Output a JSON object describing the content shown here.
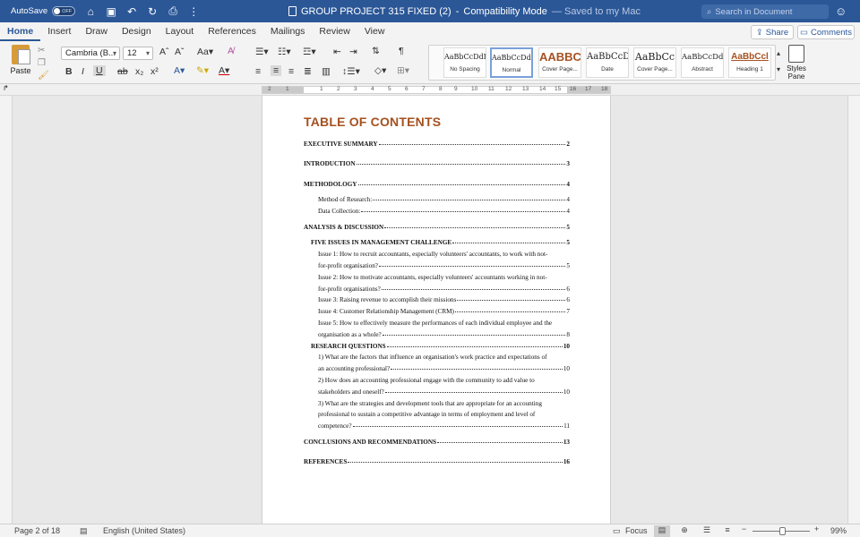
{
  "titlebar": {
    "autosave_label": "AutoSave",
    "autosave_state": "OFF",
    "doc_name": "GROUP PROJECT 315 FIXED (2)",
    "separator": "-",
    "mode": "Compatibility Mode",
    "saved": "— Saved to my Mac",
    "search_placeholder": "Search in Document"
  },
  "tabs": [
    "Home",
    "Insert",
    "Draw",
    "Design",
    "Layout",
    "References",
    "Mailings",
    "Review",
    "View"
  ],
  "share_label": "Share",
  "comments_label": "Comments",
  "ribbon": {
    "paste_label": "Paste",
    "font_name": "Cambria (B...",
    "font_size": "12",
    "styles": [
      {
        "sample": "AaBbCcDdEe",
        "name": "No Spacing"
      },
      {
        "sample": "AaBbCcDdEe",
        "name": "Normal"
      },
      {
        "sample": "AABBC",
        "name": "Cover Page..."
      },
      {
        "sample": "AaBbCcD",
        "name": "Date"
      },
      {
        "sample": "AaBbCc",
        "name": "Cover Page..."
      },
      {
        "sample": "AaBbCcDdE",
        "name": "Abstract"
      },
      {
        "sample": "AaBbCcl",
        "name": "Heading 1"
      }
    ],
    "styles_pane_label": "Styles Pane"
  },
  "ruler_numbers": [
    "2",
    "1",
    "1",
    "2",
    "3",
    "4",
    "5",
    "6",
    "7",
    "8",
    "9",
    "10",
    "11",
    "12",
    "13",
    "14",
    "15",
    "16",
    "17",
    "18"
  ],
  "document": {
    "toc_title": "TABLE OF CONTENTS",
    "entries": [
      {
        "text": "EXECUTIVE SUMMARY",
        "page": "2",
        "level": 1
      },
      {
        "text": "INTRODUCTION",
        "page": "3",
        "level": 1
      },
      {
        "text": "METHODOLOGY",
        "page": "4",
        "level": 1
      },
      {
        "text": "Method of Research:",
        "page": "4",
        "level": 3
      },
      {
        "text": "Data Collection:",
        "page": "4",
        "level": 3
      },
      {
        "text": "ANALYSIS & DISCUSSION",
        "page": "5",
        "level": 1
      },
      {
        "text": "FIVE ISSUES IN MANAGEMENT CHALLENGE",
        "page": "5",
        "level": 2
      },
      {
        "text": "Issue 1: How to recruit accountants, especially volunteers' accountants, to work with not-",
        "cont": "for-profit organisation?",
        "page": "5",
        "level": 3
      },
      {
        "text": "Issue 2: How to motivate accountants, especially volunteers' accountants working in not-",
        "cont": "for-profit organisations?",
        "page": "6",
        "level": 3
      },
      {
        "text": "Issue 3: Raising revenue to accomplish their missions",
        "page": "6",
        "level": 3
      },
      {
        "text": "Issue 4: Customer Relationship Management (CRM)",
        "page": "7",
        "level": 3
      },
      {
        "text": "Issue 5: How to effectively measure the performances of each individual employee and the",
        "cont": "organisation as a whole?",
        "page": "8",
        "level": 3
      },
      {
        "text": "RESEARCH QUESTIONS",
        "page": "10",
        "level": 2
      },
      {
        "text": "1)      What are the factors that influence an organisation's work practice and expectations of",
        "cont": "an accounting professional?",
        "page": "10",
        "level": 3
      },
      {
        "text": "2)      How does an accounting professional engage with the community to add value to",
        "cont": "stakeholders and oneself?",
        "page": "10",
        "level": 3
      },
      {
        "text": "3)      What are the strategies and development tools that are appropriate for an accounting",
        "cont2": "professional to sustain a competitive advantage in terms of employment and level of",
        "cont": "competence?",
        "page": "11",
        "level": 3
      },
      {
        "text": "CONCLUSIONS AND RECOMMENDATIONS",
        "page": "13",
        "level": 1
      },
      {
        "text": "REFERENCES",
        "page": "16",
        "level": 1
      }
    ]
  },
  "statusbar": {
    "page_info": "Page 2 of 18",
    "language": "English (United States)",
    "focus_label": "Focus",
    "zoom": "99%"
  }
}
